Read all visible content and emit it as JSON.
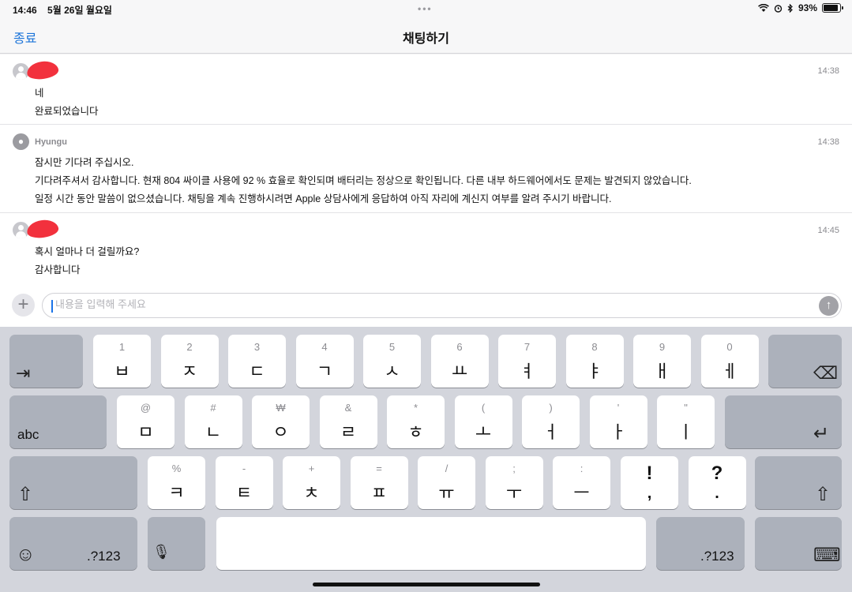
{
  "status_bar": {
    "time": "14:46",
    "date": "5월 26일 월요일",
    "battery": "93%",
    "battery_level": 0.93
  },
  "nav": {
    "close_label": "종료",
    "title": "채팅하기"
  },
  "messages": [
    {
      "sender": "",
      "time": "14:38",
      "lines": [
        "네",
        "완료되었습니다"
      ]
    },
    {
      "sender": "Hyungu",
      "time": "14:38",
      "lines": [
        "잠시만 기다려 주십시오.",
        "기다려주셔서 감사합니다. 현재 804 싸이클 사용에 92 % 효율로 확인되며 배터리는 정상으로 확인됩니다. 다른 내부 하드웨어에서도 문제는 발견되지 않았습니다.",
        "일정 시간 동안 말씀이 없으셨습니다. 채팅을 계속 진행하시려면 Apple 상담사에게 응답하여 아직 자리에 계신지 여부를 알려 주시기 바랍니다."
      ]
    },
    {
      "sender": "",
      "time": "14:45",
      "lines": [
        "혹시 얼마나 더 걸릴까요?",
        "감사합니다"
      ]
    }
  ],
  "input": {
    "placeholder": "내용을 입력해 주세요",
    "value": ""
  },
  "keyboard": {
    "row1": [
      {
        "hint": "1",
        "char": "ㅂ"
      },
      {
        "hint": "2",
        "char": "ㅈ"
      },
      {
        "hint": "3",
        "char": "ㄷ"
      },
      {
        "hint": "4",
        "char": "ㄱ"
      },
      {
        "hint": "5",
        "char": "ㅅ"
      },
      {
        "hint": "6",
        "char": "ㅛ"
      },
      {
        "hint": "7",
        "char": "ㅕ"
      },
      {
        "hint": "8",
        "char": "ㅑ"
      },
      {
        "hint": "9",
        "char": "ㅐ"
      },
      {
        "hint": "0",
        "char": "ㅔ"
      }
    ],
    "row2": [
      {
        "hint": "@",
        "char": "ㅁ"
      },
      {
        "hint": "#",
        "char": "ㄴ"
      },
      {
        "hint": "₩",
        "char": "ㅇ"
      },
      {
        "hint": "&",
        "char": "ㄹ"
      },
      {
        "hint": "*",
        "char": "ㅎ"
      },
      {
        "hint": "(",
        "char": "ㅗ"
      },
      {
        "hint": ")",
        "char": "ㅓ"
      },
      {
        "hint": "'",
        "char": "ㅏ"
      },
      {
        "hint": "\"",
        "char": "ㅣ"
      }
    ],
    "row3": [
      {
        "hint": "%",
        "char": "ㅋ"
      },
      {
        "hint": "-",
        "char": "ㅌ"
      },
      {
        "hint": "+",
        "char": "ㅊ"
      },
      {
        "hint": "=",
        "char": "ㅍ"
      },
      {
        "hint": "/",
        "char": "ㅠ"
      },
      {
        "hint": ";",
        "char": "ㅜ"
      },
      {
        "hint": ":",
        "char": "ㅡ"
      }
    ],
    "punct": [
      {
        "top": "!",
        "bottom": ","
      },
      {
        "top": "?",
        "bottom": "."
      }
    ],
    "abc_label": "abc",
    "numbers_label": ".?123",
    "icons": {
      "tab": "tab-icon",
      "delete": "delete-icon",
      "return": "return-icon",
      "shift": "shift-icon",
      "emoji": "emoji-icon",
      "mic": "microphone-icon",
      "hide_keyboard": "keyboard-hide-icon"
    }
  },
  "colors": {
    "accent": "#1a73d9",
    "redaction": "#f2313d",
    "keyboard_bg": "#d3d5dc",
    "dark_key": "#acb1bb"
  }
}
